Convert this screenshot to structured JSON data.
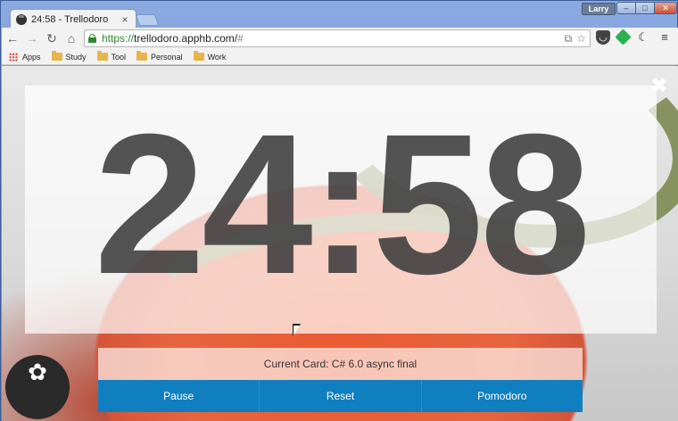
{
  "browser": {
    "tab": {
      "title": "24:58 - Trellodoro",
      "close_glyph": "×"
    },
    "user_name": "Larry",
    "window_buttons": {
      "minimize": "–",
      "maximize": "□",
      "close": "✕"
    },
    "nav": {
      "back": "←",
      "forward": "→",
      "reload": "↻",
      "home": "⌂"
    },
    "address": {
      "scheme": "https://",
      "host": "trellodoro.apphb.com/",
      "hash": "#"
    },
    "extensions": {
      "page_action": "⧉",
      "star": "☆",
      "pocket": "◡",
      "feedly": "f",
      "moon": "☾",
      "menu": "≡"
    }
  },
  "bookmarks": [
    {
      "label": "Apps",
      "icon": "apps-grid-icon"
    },
    {
      "label": "Study",
      "icon": "folder-icon"
    },
    {
      "label": "Tool",
      "icon": "folder-icon"
    },
    {
      "label": "Personal",
      "icon": "folder-icon"
    },
    {
      "label": "Work",
      "icon": "folder-icon"
    }
  ],
  "app": {
    "timer": "24:58",
    "close_glyph": "✖",
    "current_card": "Current Card: C# 6.0 async final",
    "buttons": {
      "pause": "Pause",
      "reset": "Reset",
      "pomodoro": "Pomodoro"
    },
    "logo_glyph": "✿"
  },
  "colors": {
    "accent": "#0f7fc0",
    "timer": "#3d3d3d",
    "tomato": "#ea5a32"
  }
}
